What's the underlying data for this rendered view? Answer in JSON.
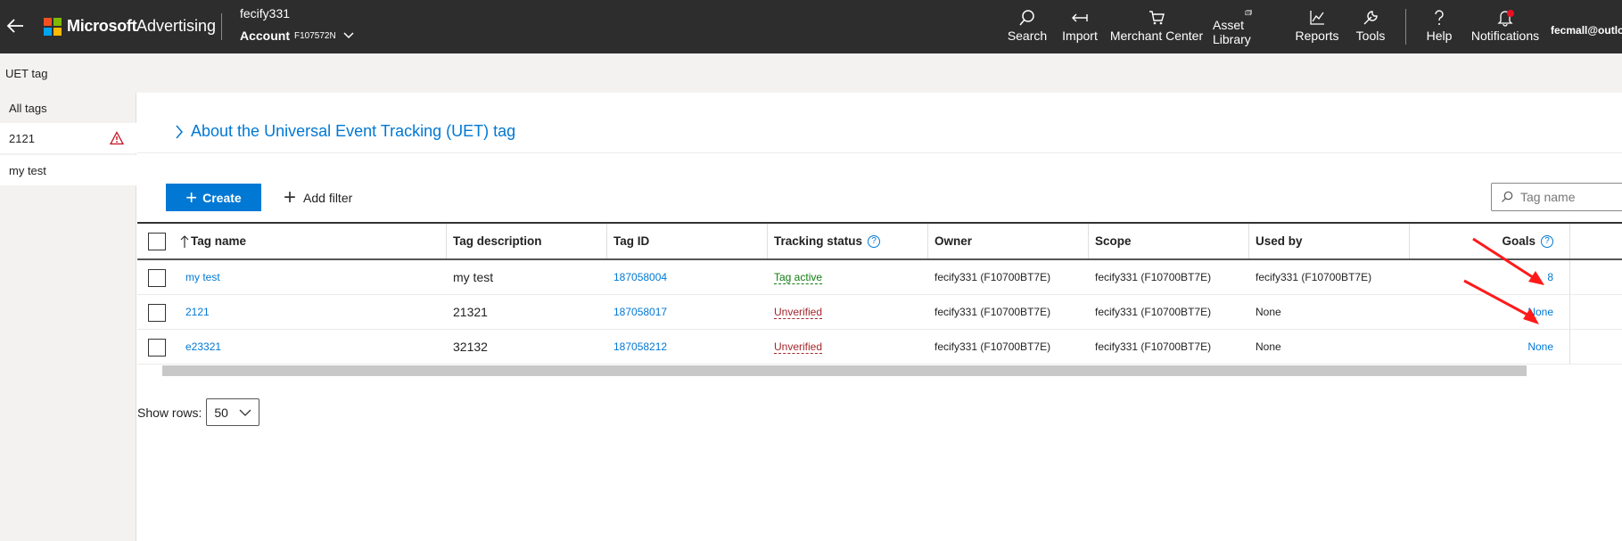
{
  "topbar": {
    "brand": "Microsoft",
    "product": "Advertising",
    "account_user": "fecify331",
    "account_label": "Account",
    "account_id": "F107572N",
    "nav": [
      {
        "label": "Search",
        "icon": "search-icon"
      },
      {
        "label": "Import",
        "icon": "import-icon"
      },
      {
        "label": "Merchant Center",
        "icon": "cart-icon"
      },
      {
        "label": "Asset Library",
        "icon": "asset-library-icon"
      },
      {
        "label": "Reports",
        "icon": "reports-icon"
      },
      {
        "label": "Tools",
        "icon": "tools-icon"
      },
      {
        "label": "Help",
        "icon": "help-icon"
      },
      {
        "label": "Notifications",
        "icon": "bell-icon"
      }
    ],
    "email": "fecmall@outlo"
  },
  "subheader": {
    "title": "UET tag"
  },
  "leftnav": {
    "items": [
      {
        "label": "All tags"
      },
      {
        "label": "2121",
        "warning": true
      },
      {
        "label": "my test"
      }
    ]
  },
  "main": {
    "about_link": "About the Universal Event Tracking (UET) tag",
    "create_label": "Create",
    "add_filter_label": "Add filter",
    "search_placeholder": "Tag name"
  },
  "table": {
    "columns": [
      "Tag name",
      "Tag description",
      "Tag ID",
      "Tracking status",
      "Owner",
      "Scope",
      "Used by",
      "Goals"
    ],
    "rows": [
      {
        "name": "my test",
        "description": "my test",
        "id": "187058004",
        "status": "Tag active",
        "status_kind": "active",
        "owner": "fecify331 (F10700BT7E)",
        "scope": "fecify331 (F10700BT7E)",
        "used_by": "fecify331 (F10700BT7E)",
        "goals": "8"
      },
      {
        "name": "2121",
        "description": "21321",
        "id": "187058017",
        "status": "Unverified",
        "status_kind": "unverified",
        "owner": "fecify331 (F10700BT7E)",
        "scope": "fecify331 (F10700BT7E)",
        "used_by": "None",
        "goals": "None"
      },
      {
        "name": "e23321",
        "description": "32132",
        "id": "187058212",
        "status": "Unverified",
        "status_kind": "unverified",
        "owner": "fecify331 (F10700BT7E)",
        "scope": "fecify331 (F10700BT7E)",
        "used_by": "None",
        "goals": "None"
      }
    ]
  },
  "pagination": {
    "show_rows_label": "Show rows:",
    "rows_value": "50"
  },
  "colors": {
    "accent": "#0078d4",
    "topbar": "#2d2d2d",
    "active": "#107c10",
    "error": "#a4262c",
    "annotation": "#ff1a1a"
  }
}
